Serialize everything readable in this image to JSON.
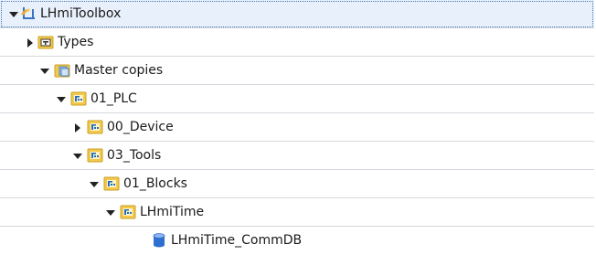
{
  "tree": {
    "root": {
      "label": "LHmiToolbox",
      "expanded": true,
      "icon": "library-icon"
    },
    "types": {
      "label": "Types",
      "expanded": false,
      "icon": "types-folder-icon"
    },
    "master_copies": {
      "label": "Master copies",
      "expanded": true,
      "icon": "master-copies-folder-icon"
    },
    "plc": {
      "label": "01_PLC",
      "expanded": true,
      "icon": "folder-icon"
    },
    "device": {
      "label": "00_Device",
      "expanded": false,
      "icon": "folder-icon"
    },
    "tools": {
      "label": "03_Tools",
      "expanded": true,
      "icon": "folder-icon"
    },
    "blocks": {
      "label": "01_Blocks",
      "expanded": true,
      "icon": "folder-icon"
    },
    "lhmitime": {
      "label": "LHmiTime",
      "expanded": true,
      "icon": "folder-icon"
    },
    "commdb": {
      "label": "LHmiTime_CommDB",
      "icon": "data-block-icon"
    }
  },
  "colors": {
    "selection_bg": "#e8f1fb",
    "folder_yellow": "#f2c94c",
    "folder_glyph_blue": "#1f6fc5",
    "db_blue": "#2f6fd0"
  }
}
